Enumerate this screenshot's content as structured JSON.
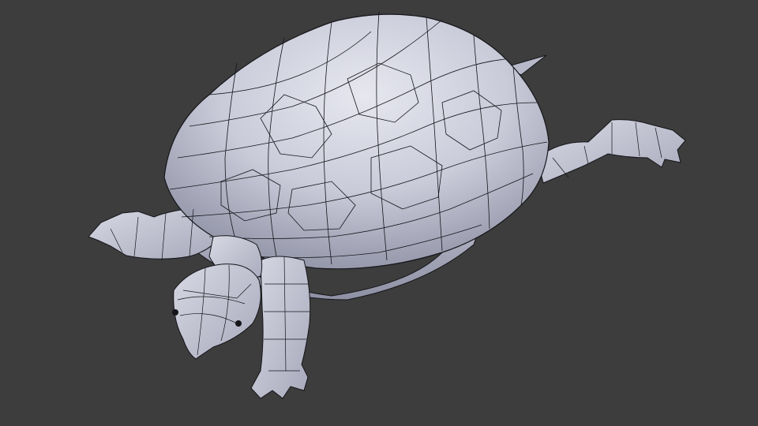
{
  "viewport": {
    "background_color": "#3d3d3d",
    "mesh_fill_color": "#c6c8d6",
    "mesh_shadow_color": "#7e8095",
    "wire_color": "#101014",
    "display_mode": "solid-with-wireframe",
    "object": "turtle-mesh"
  }
}
